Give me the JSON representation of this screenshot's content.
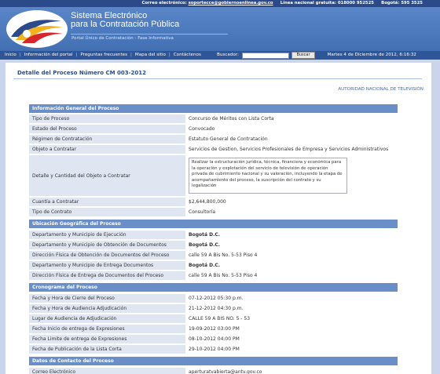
{
  "topbar": {
    "email_label": "Correo electrónico:",
    "email_value": "soportecce@gobiernoenlinea.gov.co",
    "phone_label": "Línea nacional gratuita: 018000 952525",
    "bogota_label": "Bogotá: 595 3525"
  },
  "header": {
    "title_line1": "Sistema Electrónico",
    "title_line2": "para la Contratación Pública",
    "subtitle": "Portal Único de Contratación - Fase Informativa"
  },
  "nav": {
    "items": [
      "Inicio",
      "Información del portal",
      "Preguntas frecuentes",
      "Mapa del sitio",
      "Contáctenos"
    ],
    "search_label": "Buscador:",
    "search_button": "Buscar",
    "date": "Martes 4 de Diciembre de 2012, 6:16:32"
  },
  "colors": {
    "accent": "#6a8ec8",
    "nav": "#2e5597",
    "header": "#4a78bc"
  },
  "process": {
    "title": "Detalle del Proceso Número CM 003-2012",
    "entity": "AUTORIDAD NACIONAL DE TELEVISIÓN"
  },
  "sections": {
    "general": {
      "title": "Información General del Proceso",
      "rows": [
        {
          "label": "Tipo de Proceso",
          "value": "Concurso de Méritos con Lista Corta"
        },
        {
          "label": "Estado del Proceso",
          "value": "Convocado"
        },
        {
          "label": "Régimen de Contratación",
          "value": "Estatuto General de Contratación"
        },
        {
          "label": "Objeto a Contratar",
          "value": "Servicios de Gestion, Servicios Profesionales de Empresa y Servicios Administrativos"
        },
        {
          "label": "Detalle y Cantidad del Objeto a Contratar",
          "value": "Realizar la estructuración jurídica, técnica, financiera y económica para la operación y explotación del servicio de televisión de operación privada de cubrimiento nacional y su valoración, incluyendo la etapa de acompañamiento del proceso, la suscripción del contrato y su legalización"
        },
        {
          "label": "Cuantía a Contratar",
          "value": "$2,644,800,000"
        },
        {
          "label": "Tipo de Contrato",
          "value": "Consultoría"
        }
      ]
    },
    "ubicacion": {
      "title": "Ubicación Geográfica del Proceso",
      "rows": [
        {
          "label": "Departamento y Municipio de Ejecución",
          "value": "Bogotá D.C."
        },
        {
          "label": "Departamento y Municipio de Obtención de Documentos",
          "value": "Bogotá D.C."
        },
        {
          "label": "Dirección Física de Obtención de Documentos del Proceso",
          "value": "calle 59 A Bis No. 5-53 Piso 4"
        },
        {
          "label": "Departamento y Municipio de Entrega Documentos",
          "value": "Bogotá D.C."
        },
        {
          "label": "Dirección Física de Entrega de Documentos del Proceso",
          "value": "calle 59 A Bis No. 5-53 Piso 4"
        }
      ]
    },
    "cronograma": {
      "title": "Cronograma del Proceso",
      "rows": [
        {
          "label": "Fecha y Hora de Cierre del Proceso",
          "value": "07-12-2012 05:30 p.m."
        },
        {
          "label": "Fecha y Hora de Audiencia Adjudicación",
          "value": "21-12-2012 04:30 p.m."
        },
        {
          "label": "Lugar de Audiencia de Adjudicación",
          "value": "CALLE 59 A BIS NO. 5 - 53"
        },
        {
          "label": "Fecha Inicio de entrega de Expresiones",
          "value": "19-09-2012 03:00 PM"
        },
        {
          "label": "Fecha Limite de entrega de Expresiones",
          "value": "08-10-2012 04:00 PM"
        },
        {
          "label": "Fecha de Publicación de la Lista Corta",
          "value": "29-10-2012 04:00 PM"
        }
      ]
    },
    "contacto": {
      "title": "Datos de Contacto del Proceso",
      "rows": [
        {
          "label": "Correo Electrónico",
          "value": "aperturatvabierta@antv.gov.co"
        }
      ]
    }
  }
}
